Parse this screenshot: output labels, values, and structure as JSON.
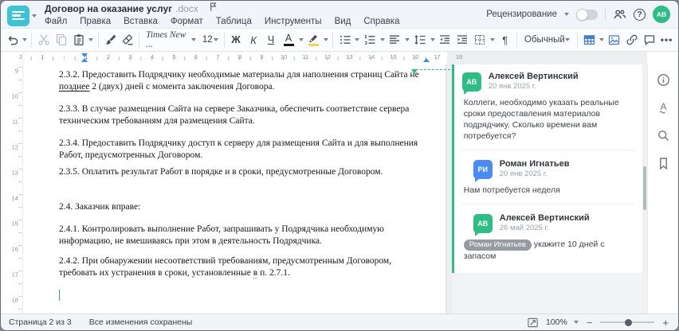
{
  "window": {
    "title": "Договор на оказание услуг",
    "ext": ".docx"
  },
  "menu": [
    "Файл",
    "Правка",
    "Вставка",
    "Формат",
    "Таблица",
    "Инструменты",
    "Вид",
    "Справка"
  ],
  "header": {
    "review_label": "Рецензирование",
    "avatar_initials": "АВ"
  },
  "toolbar": {
    "font_name": "Times New ...",
    "font_size": "12",
    "bold": "Ж",
    "italic": "К",
    "underline": "Ч",
    "font_color_letter": "А",
    "pilcrow": "¶",
    "style_name": "Обычный",
    "more": "•••"
  },
  "ruler": {
    "h_margin_numbers": [
      {
        "v": -2,
        "label": "2"
      },
      {
        "v": -1,
        "label": "1"
      }
    ],
    "h_numbers": [
      "1",
      "2",
      "3",
      "4",
      "5",
      "6",
      "7",
      "8",
      "9",
      "10",
      "11",
      "12",
      "13",
      "14",
      "15",
      "16",
      "17",
      "18"
    ],
    "v_numbers": [
      "9",
      "10",
      "11",
      "12",
      "13",
      "14",
      "15",
      "16",
      "17",
      "18"
    ]
  },
  "doc": {
    "paragraphs": [
      {
        "before": "2.3.2. Предоставить Подрядчику необходимые материалы для наполнения страниц Сайта не ",
        "marked": "позднее",
        "after": " 2 (двух) дней с момента заключения Договора."
      },
      {
        "text": "2.3.3. В случае размещения Сайта на сервере Заказчика, обеспечить соответствие сервера техническим требованиям для размещения Сайта."
      },
      {
        "text": "2.3.4. Предоставить Подрядчику доступ к серверу для размещения Сайта и для выполнения Работ, предусмотренных Договором."
      },
      {
        "text": "2.3.5. Оплатить результат Работ в порядке и в сроки, предусмотренные Договором."
      },
      {
        "text": "2.4. Заказчик вправе:"
      },
      {
        "text": "2.4.1. Контролировать выполнение Работ, запрашивать у Подрядчика необходимую информацию, не вмешиваясь при этом в деятельность Подрядчика."
      },
      {
        "before": "2.4.2. При обнаружении несоответствий требованиям, предусмотренным Договором, требовать их устранения в сроки, установленные ",
        "spell": "в",
        "after": " п. 2.7.1."
      }
    ]
  },
  "comments": [
    {
      "initials": "АВ",
      "color": "#2ebd85",
      "name": "Алексей Вертинский",
      "date": "20 янв 2025 г.",
      "text": "Коллеги, необходимо указать реальные сроки предоставления материалов подрядчику. Сколько времени вам потребуется?",
      "reply": false
    },
    {
      "initials": "РИ",
      "color": "#4b8bf5",
      "name": "Роман Игнатьев",
      "date": "20 янв 2025 г.",
      "text": "Нам потребуется неделя",
      "reply": true
    },
    {
      "initials": "АВ",
      "color": "#2ebd85",
      "name": "Алексей Вертинский",
      "date": "26 май 2025 г.",
      "mention": "Роман Игнатьев",
      "text": " укажите 10 дней с запасом",
      "reply": true
    }
  ],
  "statusbar": {
    "page_label": "Страница 2 из 3",
    "saved_label": "Все изменения сохранены",
    "zoom_value": "100%"
  },
  "colors": {
    "accent_green": "#2ebd85",
    "avatar_blue": "#4b8bf5",
    "indent_blue": "#3d8ce8",
    "logo_teal": "#3cc4d2"
  }
}
